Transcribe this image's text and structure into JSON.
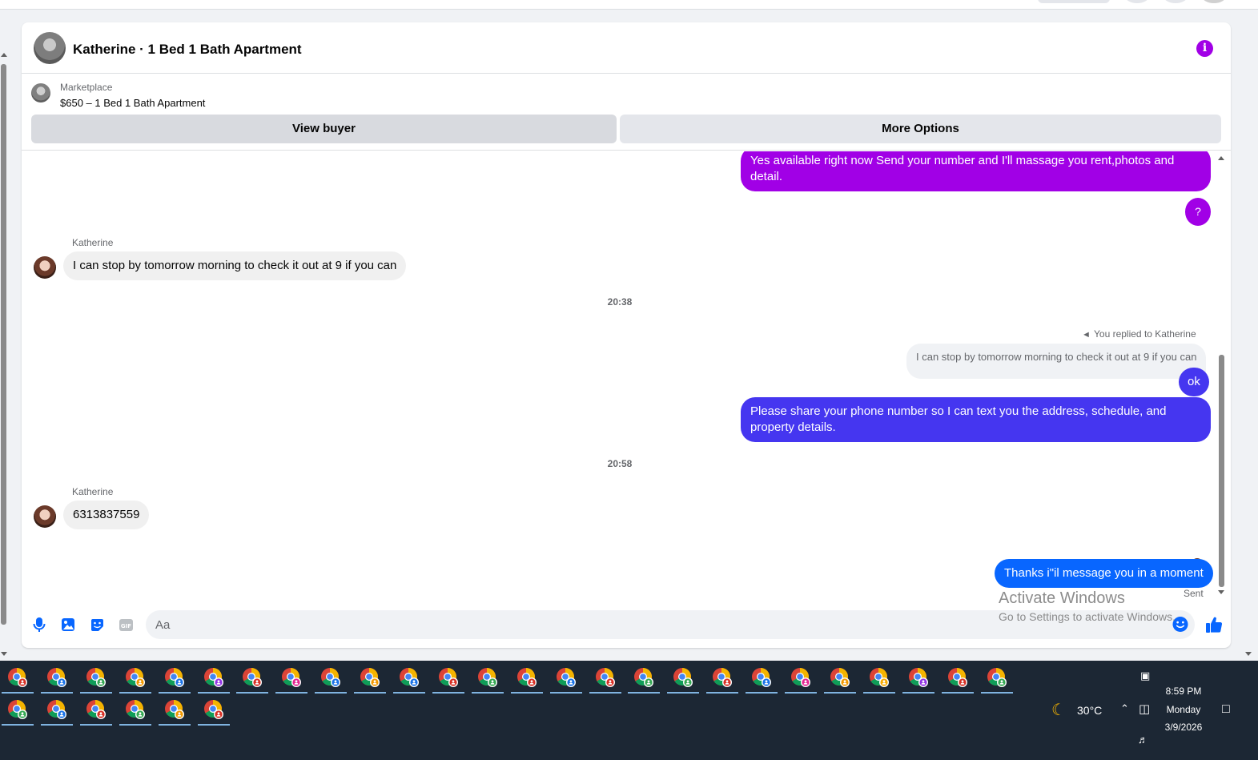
{
  "chat": {
    "title": "Katherine · 1 Bed 1 Bath Apartment",
    "listing_source": "Marketplace",
    "listing_name": "$650 – 1 Bed 1 Bath Apartment",
    "view_buyer_label": "View buyer",
    "more_options_label": "More Options"
  },
  "messages": {
    "m1": "Yes available right now Send your number and I'll massage you rent,photos and detail.",
    "q": "?",
    "sender1": "Katherine",
    "m2": "I can stop by tomorrow morning to check it out at 9 if you can",
    "time1": "20:38",
    "replied_to": "You replied to Katherine",
    "quoted": "I can stop by tomorrow morning to check it out at 9 if you can",
    "m3": "ok",
    "m4": "Please share your phone number so I can text you the address, schedule, and property details.",
    "time2": "20:58",
    "sender2": "Katherine",
    "m5": "6313837559",
    "m6": "Thanks i\"il message you in a moment",
    "status": "Sent"
  },
  "composer": {
    "placeholder": "Aa"
  },
  "watermark": {
    "line1": "Activate Windows",
    "line2": "Go to Settings to activate Windows."
  },
  "taskbar": {
    "apps_row1": [
      "chrome-red",
      "chrome-blue",
      "chrome-green",
      "chrome-orange",
      "chrome-blue",
      "chrome-purple",
      "chrome-red",
      "chrome-pink",
      "chrome-blue",
      "chrome-orange",
      "chrome-blue",
      "chrome-red",
      "chrome-green",
      "chrome-red",
      "chrome-blue",
      "chrome-red",
      "chrome-green",
      "chrome-green",
      "chrome-red",
      "chrome-blue",
      "chrome-pink",
      "chrome-orange",
      "chrome-yellow",
      "chrome-purple",
      "chrome-red",
      "chrome-green"
    ],
    "apps_row2": [
      "chrome-green",
      "chrome-blue",
      "chrome-red",
      "chrome-green",
      "chrome-orange",
      "chrome-red"
    ],
    "weather": "30°C",
    "time": "8:59 PM",
    "day": "Monday",
    "date": "3/9/2026"
  },
  "colors": {
    "accent_purple": "#a100e6",
    "accent_blue": "#4536f0",
    "messenger_blue": "#0866ff",
    "taskbar": "#1c2734"
  }
}
